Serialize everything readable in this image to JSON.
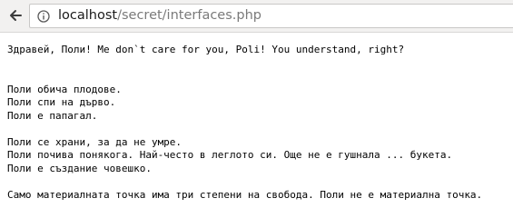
{
  "browser": {
    "url_host": "localhost",
    "url_path": "/secret/interfaces.php",
    "back_icon": "back-arrow-icon",
    "info_icon": "info-icon"
  },
  "page": {
    "greeting": "Здравей, Поли! Me don`t care for you, Poli! You understand, right?",
    "block1": [
      "Поли обича плодове.",
      "Поли спи на дърво.",
      "Поли е папагал."
    ],
    "block2": [
      "Поли се храни, за да не умре.",
      "Поли почива понякога. Най-често в леглото си. Още не е гушнала ... букета.",
      "Поли е създание човешко."
    ],
    "closing": "Само материалната точка има три степени на свобода. Поли не е материална точка."
  }
}
